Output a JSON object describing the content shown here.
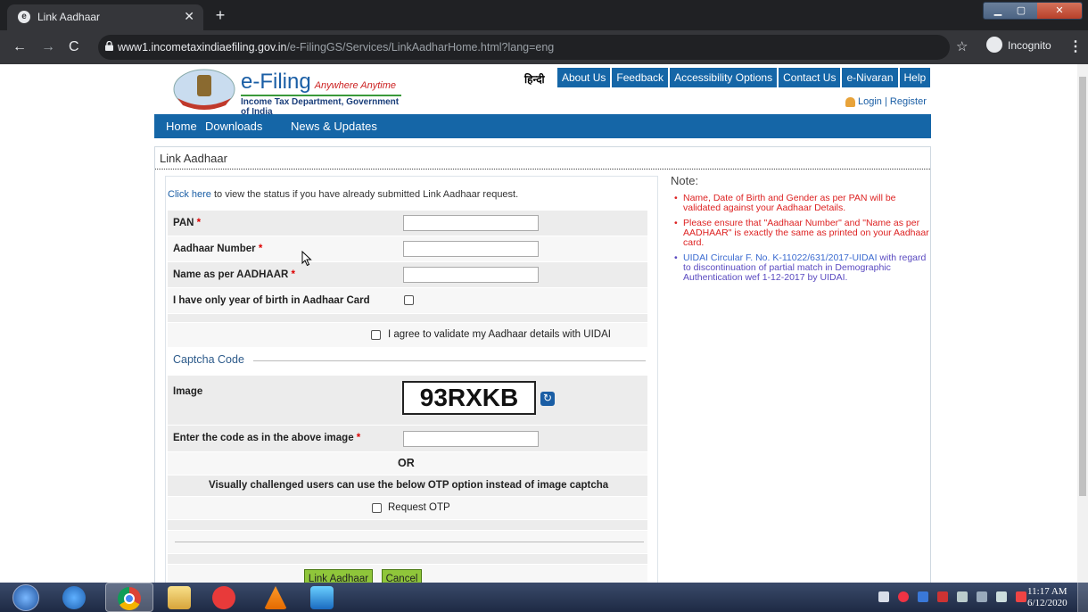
{
  "browser": {
    "tab_title": "Link Aadhaar",
    "url_host": "www1.incometaxindiaefiling.gov.in",
    "url_path": "/e-FilingGS/Services/LinkAadharHome.html?lang=eng",
    "incognito_label": "Incognito"
  },
  "site": {
    "title": "e-Filing",
    "tagline": "Anywhere Anytime",
    "subtitle": "Income Tax Department, Government of India",
    "hindi_link": "हिन्दी",
    "top_menu": [
      "About Us",
      "Feedback",
      "Accessibility Options",
      "Contact Us",
      "e-Nivaran",
      "Help"
    ],
    "login": "Login",
    "register": "Register",
    "main_nav": [
      "Home",
      "Downloads",
      "News & Updates"
    ]
  },
  "page": {
    "title": "Link Aadhaar",
    "status_link": "Click here",
    "status_text": " to view the status if you have already submitted Link Aadhaar request."
  },
  "form": {
    "pan_label": "PAN",
    "aadhaar_label": "Aadhaar Number",
    "name_label": "Name as per AADHAAR",
    "yob_label": "I have only year of birth in Aadhaar Card",
    "agree_label": "I agree to validate my Aadhaar details with UIDAI",
    "captcha_legend": "Captcha Code",
    "image_label": "Image",
    "captcha_text": "93RXKB",
    "captcha_entry_label": "Enter the code as in the above image",
    "or_text": "OR",
    "otp_note": "Visually challenged users can use the below OTP option instead of image captcha",
    "otp_label": "Request OTP",
    "submit_label": "Link Aadhaar",
    "cancel_label": "Cancel",
    "required_mark": "*"
  },
  "notes": {
    "title": "Note:",
    "items": [
      "Name, Date of Birth and Gender as per PAN will be validated against your Aadhaar Details.",
      "Please ensure that \"Aadhaar Number\" and \"Name as per AADHAAR\" is exactly the same as printed on your Aadhaar card.",
      "UIDAI Circular F. No. K-11022/631/2017-UIDAI",
      "with regard to discontinuation of partial match in Demographic Authentication wef 1-12-2017 by UIDAI."
    ]
  },
  "taskbar": {
    "time": "11:17 AM",
    "date": "6/12/2020"
  }
}
